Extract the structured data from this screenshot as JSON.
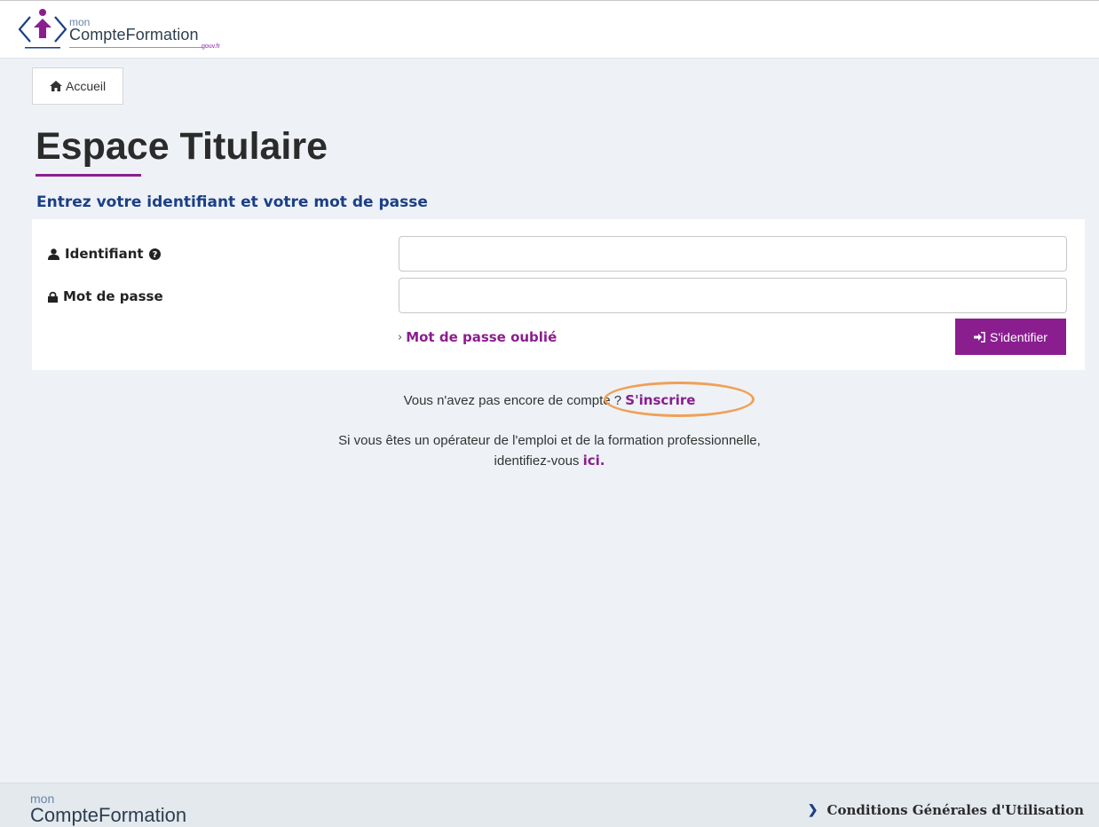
{
  "header": {
    "logo_prefix": "mon",
    "logo_name": "CompteFormation",
    "logo_domain": "gouv.fr"
  },
  "breadcrumb": {
    "home_label": "Accueil"
  },
  "page": {
    "title": "Espace Titulaire",
    "form_heading": "Entrez votre identifiant et votre mot de passe"
  },
  "form": {
    "identifier_label": "Identifiant",
    "identifier_value": "",
    "password_label": "Mot de passe",
    "password_value": "",
    "forgot_password_label": "Mot de passe oublié",
    "login_button_label": "S'identifier"
  },
  "signup": {
    "prompt": "Vous n'avez pas encore de compte ?",
    "link_label": "S'inscrire"
  },
  "operator": {
    "line1": "Si vous êtes un opérateur de l'emploi et de la formation professionnelle,",
    "line2_prefix": "identifiez-vous",
    "link_label": "ici."
  },
  "footer": {
    "logo_prefix": "mon",
    "logo_name": "CompteFormation",
    "cgu_label": "Conditions Générales d'Utilisation"
  },
  "colors": {
    "accent_purple": "#8a1e8f",
    "heading_blue": "#1b3f87",
    "annotation_orange": "#f0a057"
  },
  "icons": [
    "logo-person-icon",
    "home-icon",
    "user-icon",
    "question-circle-icon",
    "lock-icon",
    "chevron-right-icon",
    "sign-in-icon"
  ]
}
